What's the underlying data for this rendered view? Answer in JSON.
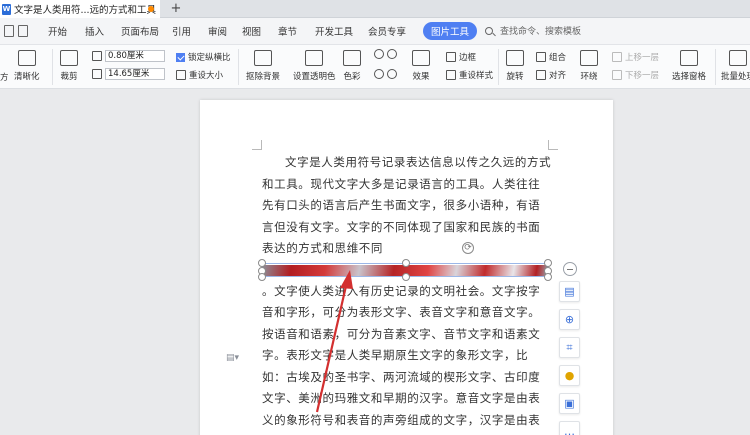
{
  "titlebar": {
    "doc_tab_title": "文字是人类用符...远的方式和工具",
    "doc_icon": "W",
    "new_tab": "+"
  },
  "menu": {
    "items": [
      "开始",
      "插入",
      "页面布局",
      "引用",
      "审阅",
      "视图",
      "章节",
      "开发工具",
      "会员专享"
    ],
    "active_tab": "图片工具",
    "search_placeholder": "查找命令、搜索模板"
  },
  "toolbar": {
    "left_cut_1": "方",
    "clear_label": "清晰化",
    "crop_label": "裁剪",
    "width_value": "0.80厘米",
    "height_value": "14.65厘米",
    "lock_ratio_label": "锁定纵横比",
    "reset_size_label": "重设大小",
    "remove_bg_label": "抠除背景",
    "transparent_label": "设置透明色",
    "color_label": "色彩",
    "effect_label": "效果",
    "border_label": "边框",
    "reset_style_label": "重设样式",
    "rotate_label": "旋转",
    "group_label": "组合",
    "align_label": "对齐",
    "wrap_label": "环绕",
    "bring_forward_label": "上移一层",
    "send_backward_label": "下移一层",
    "selection_pane_label": "选择窗格",
    "batch_label": "批量处理"
  },
  "document": {
    "para1": "文字是人类用符号记录表达信息以传之久远的方式和工具。现代文字大多是记录语言的工具。人类往往先有口头的语言后产生书面文字，很多小语种，有语言但没有文字。文字的不同体现了国家和民族的书面表达的方式和思维不同",
    "para2": "。文字使人类进入有历史记录的文明社会。文字按字音和字形，可分为表形文字、表音文字和意音文字。按语音和语素，可分为音素文字、音节文字和语素文字。表形文字是人类早期原生文字的象形文字，比如：古埃及的圣书字、两河流域的楔形文字、古印度文字、美洲的玛雅文和早期的汉字。意音文字是由表义的象形符号和表音的声旁组成的文字，汉字是由表形文字"
  },
  "colors": {
    "accent": "#4f7ff2",
    "arrow": "#d32f2f",
    "unsaved_dot": "#ff8a00"
  }
}
